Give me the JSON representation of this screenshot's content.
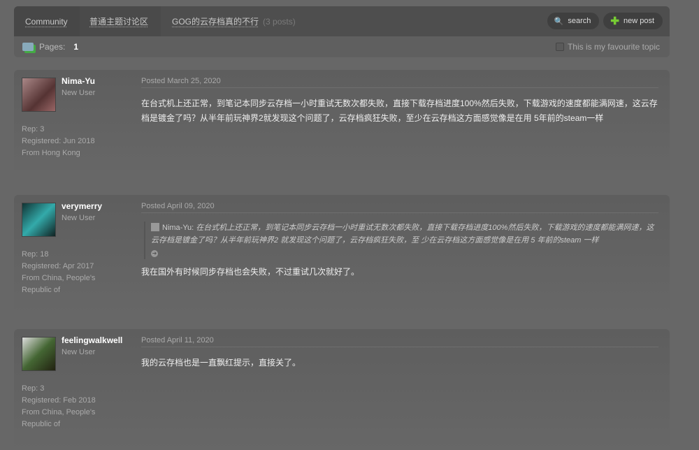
{
  "breadcrumb": {
    "community": "Community",
    "forum": "普通主题讨论区",
    "topic": "GOG的云存档真的不行",
    "count": "(3 posts)"
  },
  "toolbar": {
    "search": "search",
    "new_post": "new post"
  },
  "pages": {
    "label": "Pages:",
    "current": "1"
  },
  "favourite": "This is my favourite topic",
  "posts": [
    {
      "user": "Nima-Yu",
      "role": "New User",
      "rep": "Rep: 3",
      "registered": "Registered: Jun 2018",
      "from": "From Hong Kong",
      "date": "Posted March 25, 2020",
      "text": "在台式机上还正常，到笔记本同步云存档一小时重试无数次都失败，直接下载存档进度100%然后失败，下载游戏的速度都能满网速，这云存档是镀金了吗？从半年前玩神界2就发现这个问题了，云存档疯狂失败，至少在云存档这方面感觉像是在用 5年前的steam一样"
    },
    {
      "user": "verymerry",
      "role": "New User",
      "rep": "Rep: 18",
      "registered": "Registered: Apr 2017",
      "from": "From China, People's Republic of",
      "date": "Posted April 09, 2020",
      "quote_user": "Nima-Yu:",
      "quote": "在台式机上还正常，到笔记本同步云存档一小时重试无数次都失败，直接下载存档进度100%然后失败，下载游戏的速度都能满网速，这云存档是镀金了吗？从半年前玩神界2 就发现这个问题了，云存档疯狂失败，至 少在云存档这方面感觉像是在用 5 年前的steam 一样",
      "text": "我在国外有时候同步存档也会失败，不过重试几次就好了。"
    },
    {
      "user": "feelingwalkwell",
      "role": "New User",
      "rep": "Rep: 3",
      "registered": "Registered: Feb 2018",
      "from": "From China, People's Republic of",
      "date": "Posted April 11, 2020",
      "text": "我的云存档也是一直飘红提示，直接关了。"
    }
  ]
}
